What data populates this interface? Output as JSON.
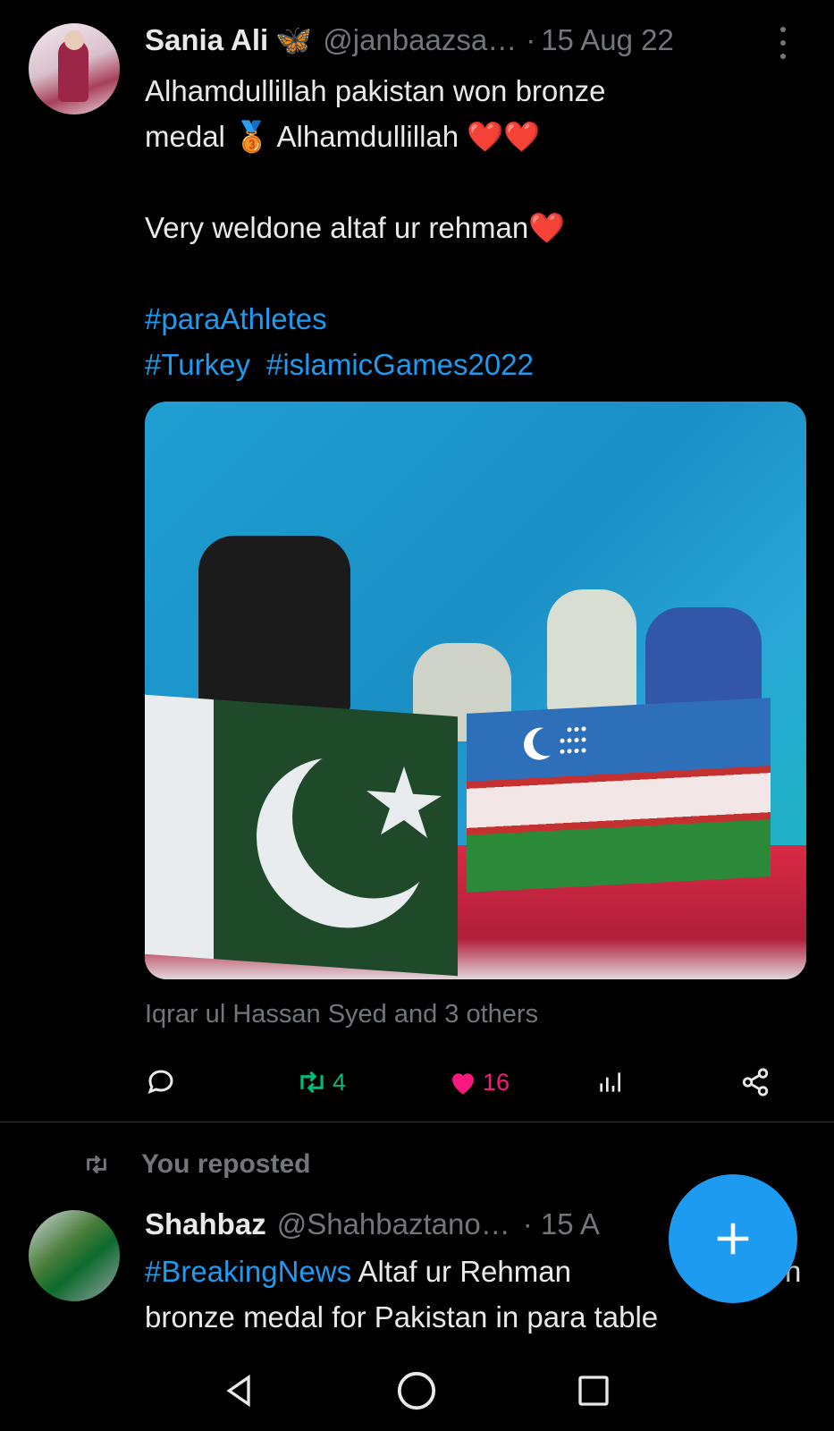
{
  "tweet1": {
    "author_name": "Sania Ali",
    "author_emoji": "🦋",
    "handle": "@janbaazsa…",
    "separator": "·",
    "date": "15 Aug 22",
    "line1": "Alhamdullillah pakistan won bronze",
    "line2_a": "medal",
    "line2_emoji": "🥉",
    "line2_b": "Alhamdullillah",
    "line2_hearts": "❤️❤️",
    "line3": "Very weldone altaf ur rehman",
    "line3_heart": "❤️",
    "hashtag1": "#paraAthletes",
    "hashtag2": "#Turkey",
    "hashtag3": "#islamicGames2022",
    "liked_by": "Iqrar ul Hassan Syed and 3 others",
    "retweet_count": "4",
    "like_count": "16"
  },
  "repost": {
    "label": "You reposted"
  },
  "tweet2": {
    "author_name": "Shahbaz",
    "handle": "@Shahbaztano…",
    "date": "· 15 A",
    "hashtag": "#BreakingNews",
    "line1_rest": "Altaf ur Rehman",
    "line1_tail": "n",
    "line2": "bronze medal for Pakistan in para table"
  },
  "colors": {
    "background": "#000000",
    "text": "#e7e9ea",
    "muted": "#71767b",
    "link": "#1d9bf0",
    "retweet_green": "#00ba7c",
    "like_pink": "#f91880"
  }
}
